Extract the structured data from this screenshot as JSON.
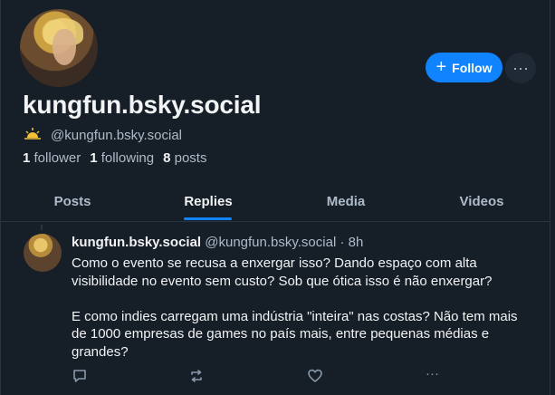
{
  "profile": {
    "display_name": "kungfun.bsky.social",
    "handle": "@kungfun.bsky.social",
    "stats": {
      "followers_count": "1",
      "followers_label": "follower",
      "following_count": "1",
      "following_label": "following",
      "posts_count": "8",
      "posts_label": "posts"
    }
  },
  "actions": {
    "follow_label": "Follow",
    "more_glyph": "···"
  },
  "tabs": [
    {
      "label": "Posts"
    },
    {
      "label": "Replies"
    },
    {
      "label": "Media"
    },
    {
      "label": "Videos"
    }
  ],
  "post": {
    "author_name": "kungfun.bsky.social",
    "author_handle": "@kungfun.bsky.social",
    "separator": "·",
    "time": "8h",
    "paragraphs": [
      "Como o evento se recusa a enxergar isso? Dando espaço com alta visibilidade no evento sem custo? Sob que ótica isso é não enxergar?",
      "E como indies carregam uma indústria \"inteira\" nas costas? Não tem mais de 1000 empresas de games no país mais, entre pequenas médias e grandes?"
    ],
    "more_glyph": "···"
  },
  "colors": {
    "accent": "#1083fe",
    "background": "#161e27",
    "muted_text": "#aebbc9"
  },
  "icons": [
    "plus-icon",
    "more-icon",
    "sun-icon",
    "reply-icon",
    "repost-icon",
    "like-icon",
    "post-more-icon"
  ]
}
